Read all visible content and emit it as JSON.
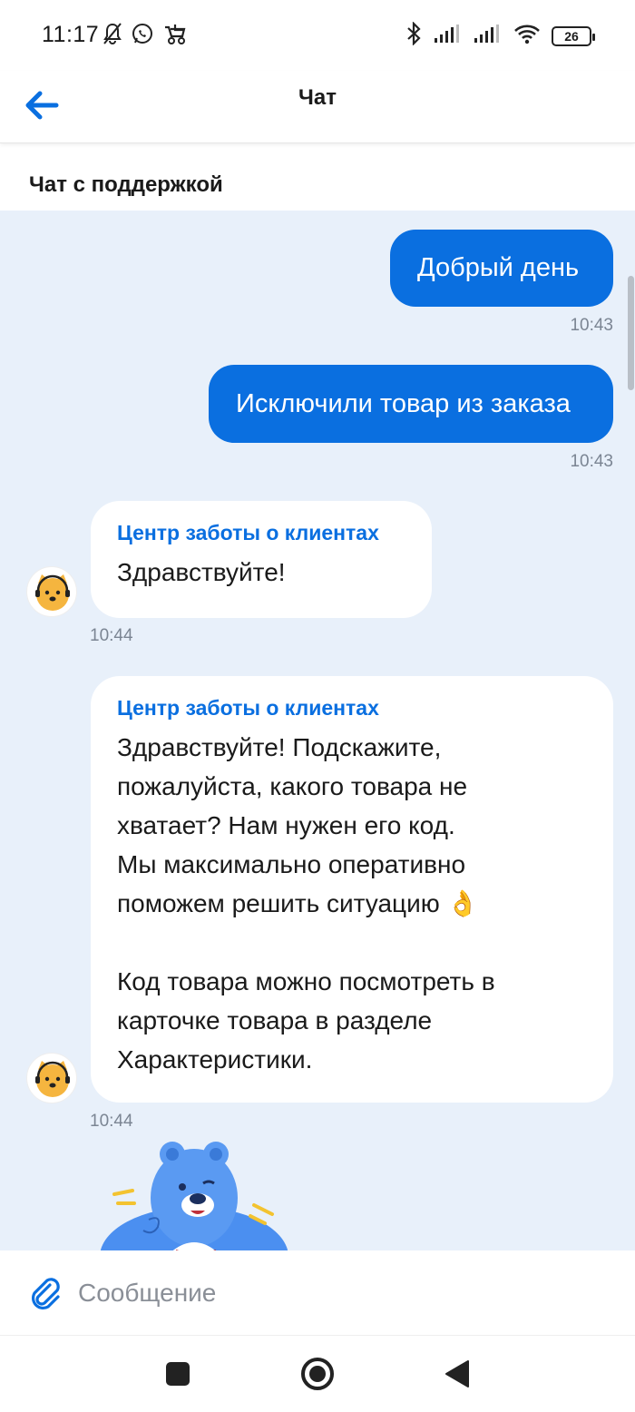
{
  "status_bar": {
    "time": "11:17",
    "left_icons": [
      "bell-muted-icon",
      "whatsapp-icon",
      "stroller-icon"
    ],
    "right_icons": [
      "bluetooth-icon",
      "signal-icon",
      "signal-icon",
      "wifi-icon"
    ],
    "battery": "26"
  },
  "header": {
    "title": "Чат",
    "back_icon": "arrow-left-icon"
  },
  "chat": {
    "section_title": "Чат с поддержкой",
    "messages": [
      {
        "direction": "out",
        "text": "Добрый день",
        "time": "10:43"
      },
      {
        "direction": "out",
        "text": "Исключили товар из заказа",
        "time": "10:43"
      },
      {
        "direction": "in",
        "sender": "Центр заботы о клиентах",
        "text": "Здравствуйте!",
        "time": "10:44"
      },
      {
        "direction": "in",
        "sender": "Центр заботы о клиентах",
        "text": "Здравствуйте! Подскажите,\nпожалуйста, какого товара не\nхватает? Нам нужен его код.\nМы максимально оперативно\nпоможем решить ситуацию 👌\n\nКод товара можно посмотреть в\nкарточке товара в разделе\nХарактеристики.",
        "time": "10:44"
      }
    ],
    "sticker": "bear-sticker"
  },
  "input": {
    "placeholder": "Сообщение",
    "attach_icon": "paperclip-icon"
  },
  "colors": {
    "accent": "#0a6fe0",
    "chat_background": "#e8f0fa",
    "incoming_bubble": "#ffffff",
    "timestamp": "#7b8593"
  },
  "nav": {
    "buttons": [
      "recents-square-icon",
      "home-circle-icon",
      "back-triangle-icon"
    ]
  }
}
